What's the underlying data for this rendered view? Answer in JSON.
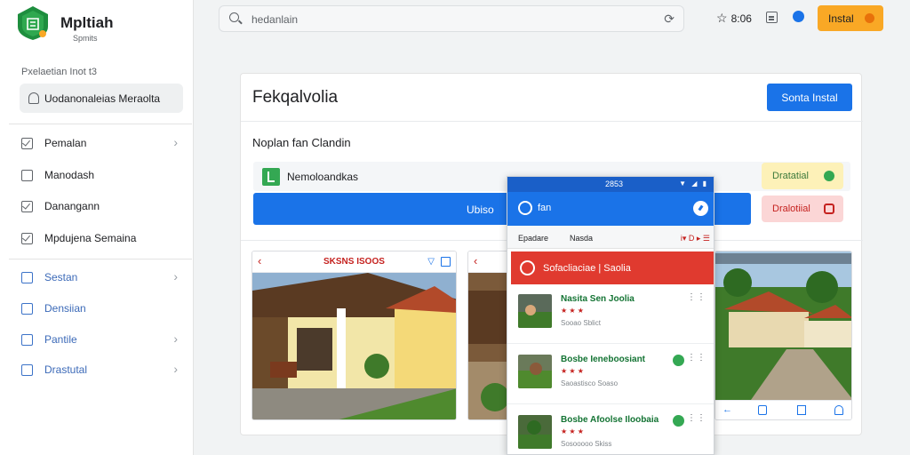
{
  "app": {
    "name": "Mpltiah",
    "subtitle": "Spmits"
  },
  "sidebar": {
    "section_label": "Pxelaetian Inot t3",
    "active_item": "Uodanonaleias Meraolta",
    "items": [
      {
        "label": "Pemalan",
        "icon": "edit-icon",
        "chevron": "›"
      },
      {
        "label": "Manodash",
        "icon": "box-icon",
        "chevron": ""
      },
      {
        "label": "Danangann",
        "icon": "checkbox-icon",
        "chevron": ""
      },
      {
        "label": "Mpdujena Semaina",
        "icon": "checkbox-icon",
        "chevron": ""
      }
    ],
    "items2": [
      {
        "label": "Sestan",
        "icon": "folder-icon",
        "chevron": "›"
      },
      {
        "label": "Densiian",
        "icon": "folder-icon",
        "chevron": ""
      },
      {
        "label": "Pantile",
        "icon": "folder-icon",
        "chevron": "›"
      },
      {
        "label": "Drastutal",
        "icon": "folder-icon",
        "chevron": "›"
      }
    ]
  },
  "topbar": {
    "search_text": "hedanlain",
    "star_label": "8:06",
    "install_label": "Instal",
    "colors": {
      "install": "#f9a825",
      "accent": "#1a73e8"
    }
  },
  "card": {
    "title": "Fekqalvolia",
    "primary_button": "Sonta Instal",
    "subheading": "Noplan fan Clandin",
    "row_grey_label": "Nemoloandkas",
    "row_blue_label": "Ubiso",
    "pill_yellow": "Dratatial",
    "pill_pink": "Dralotiial"
  },
  "photos": {
    "left_title": "SKSNS ISOOS",
    "scene_left": "house-veranda-photo",
    "scene_right": "garden-courtyard-photo"
  },
  "phone": {
    "time": "2853",
    "appbar_label": "fan",
    "tab1": "Epadare",
    "tab2": "Nasda",
    "tab3": "i▾ D ▸ ☰",
    "banner": "Sofacliaciae | Saolia",
    "items": [
      {
        "name": "Nasita  Sen Joolia",
        "stars": "★ ★ ★",
        "meta": "Sooao Sblict"
      },
      {
        "name": "Bosbe  Ieneboosiant",
        "stars": "★ ★ ★",
        "meta": "Saoastisco Soaso"
      },
      {
        "name": "Bosbe  Afoolse Iloobaia",
        "stars": "★ ★ ★",
        "meta": "Sosooooo Skiss"
      }
    ]
  }
}
